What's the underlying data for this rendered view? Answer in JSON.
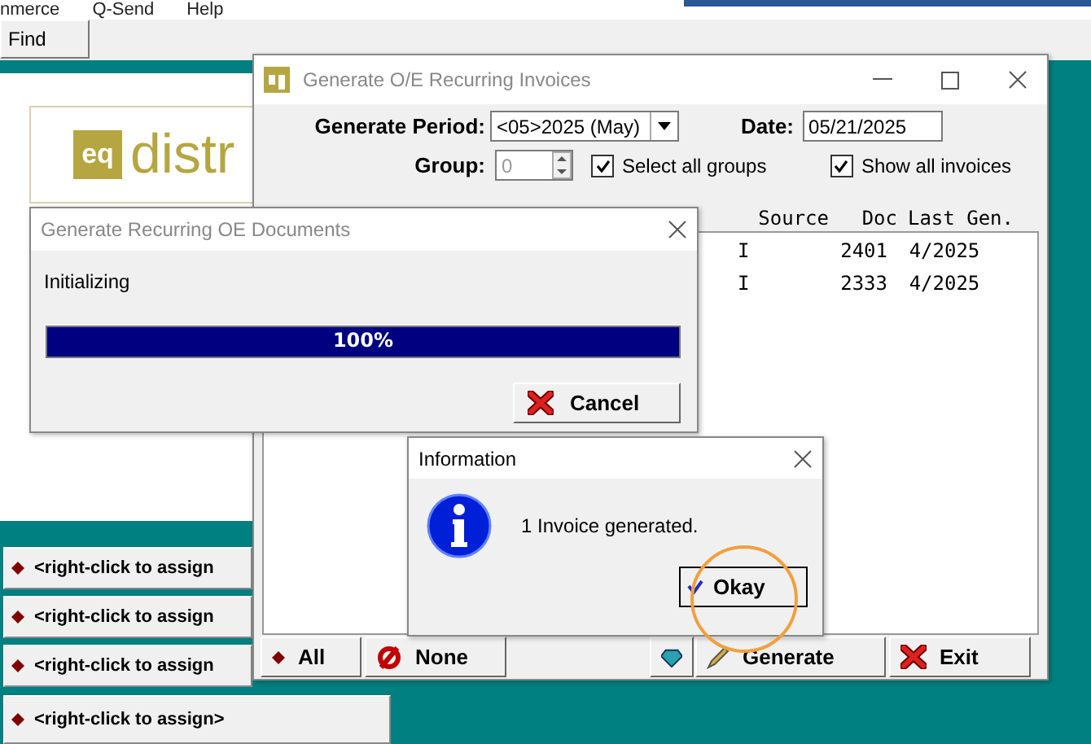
{
  "menu_bar": {
    "items": [
      "nmerce",
      "Q-Send",
      "Help"
    ]
  },
  "toolbar": {
    "buttons": [
      "Find"
    ]
  },
  "logo": {
    "mark": "eq",
    "text": "distr"
  },
  "shortcut_buttons": [
    "<right-click to assign",
    "<right-click to assign",
    "<right-click to assign",
    "<right-click to assign>"
  ],
  "main_window": {
    "title": "Generate O/E Recurring Invoices",
    "active": false,
    "generate_period": {
      "label": "Generate Period:",
      "value": "<05>2025 (May)"
    },
    "date": {
      "label": "Date:",
      "value": "05/21/2025"
    },
    "group": {
      "label": "Group:",
      "value": "0",
      "disabled": true
    },
    "checkboxes": [
      {
        "label": "Select all groups",
        "checked": true
      },
      {
        "label": "Show all invoices",
        "checked": true
      }
    ],
    "table": {
      "columns": [
        "Source",
        "Doc",
        "Last Gen."
      ],
      "rows": [
        [
          "I",
          "2401",
          "4/2025"
        ],
        [
          "I",
          "2333",
          "4/2025"
        ]
      ]
    },
    "buttons": [
      {
        "label": "All",
        "kind": "all"
      },
      {
        "label": "None",
        "kind": "none"
      },
      {
        "kind": "icon"
      },
      {
        "label": "Generate",
        "kind": "generate"
      },
      {
        "label": "Exit",
        "kind": "exit"
      }
    ]
  },
  "progress_dialog": {
    "title": "Generate Recurring OE Documents",
    "status": "Initializing",
    "level": 1,
    "reading": "100%",
    "button": "Cancel"
  },
  "info_dialog": {
    "title": "Information",
    "message": "1 Invoice generated.",
    "button": "Okay",
    "highlighted": true
  }
}
